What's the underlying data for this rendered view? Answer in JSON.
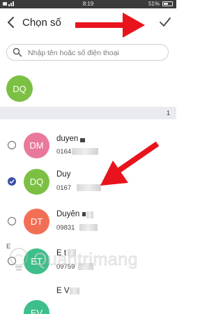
{
  "status_bar": {
    "time": "8:19",
    "battery_text": "51%"
  },
  "header": {
    "back_icon": "back-chevron-icon",
    "title": "Chọn số",
    "confirm_icon": "check-icon"
  },
  "search": {
    "placeholder": "Nhập tên hoặc số điện thoại",
    "icon": "search-icon"
  },
  "selected_contacts": [
    {
      "initials": "DQ",
      "color": "#7bc043"
    }
  ],
  "section": {
    "selected_count": "1"
  },
  "contacts": [
    {
      "initials": "DM",
      "name": "duyen",
      "phone": "0164",
      "color": "#e8799a",
      "checked": false
    },
    {
      "initials": "DQ",
      "name": "Duy",
      "phone": "0167",
      "color": "#7bc043",
      "checked": true
    },
    {
      "initials": "DT",
      "name": "Duyên",
      "phone": "09831",
      "color": "#f26f55",
      "checked": false
    },
    {
      "initials": "ET",
      "name": "E t",
      "phone": "09759",
      "color": "#3ebf8a",
      "checked": false
    },
    {
      "initials": "EV",
      "name": "E V",
      "phone": "",
      "color": "#3ebf8a",
      "checked": false
    }
  ],
  "index_letter": "E",
  "watermark": {
    "text": "Quantrimang",
    "icon": "lightbulb-icon"
  },
  "colors": {
    "accent": "#3b4fa8",
    "arrow": "#e8131c",
    "status_bar": "#3b3b3b",
    "section_bar": "#e9ebf0"
  }
}
